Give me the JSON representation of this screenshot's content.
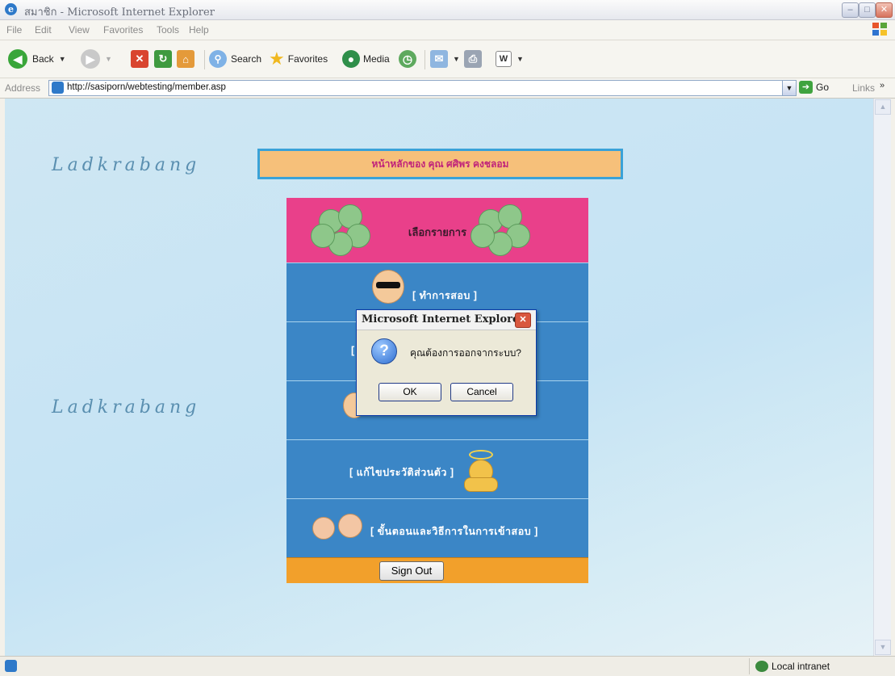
{
  "window": {
    "title": "สมาชิก - Microsoft Internet Explorer",
    "minimize": "–",
    "maximize": "□",
    "close": "✕"
  },
  "menubar": [
    "File",
    "Edit",
    "View",
    "Favorites",
    "Tools",
    "Help"
  ],
  "toolbar": {
    "back": "Back",
    "search": "Search",
    "favorites": "Favorites",
    "media": "Media"
  },
  "addressbar": {
    "label": "Address",
    "url": "http://sasiporn/webtesting/member.asp",
    "go": "Go",
    "links": "Links"
  },
  "page": {
    "brand_top": "Ladkrabang",
    "brand_mid": "Ladkrabang",
    "welcome": "หน้าหลักของ คุณ  ศศิพร   คงชลอม",
    "menu_title": "เลือกรายการ",
    "menu_items": [
      "[ ทำการสอบ ]",
      "[",
      "",
      "[ แก้ไขประวัติส่วนตัว ]",
      "[ ขั้นตอนและวิธีการในการเข้าสอบ ]"
    ],
    "signout": "Sign Out"
  },
  "dialog": {
    "title": "Microsoft Internet Explorer",
    "message": "คุณต้องการออกจากระบบ?",
    "ok": "OK",
    "cancel": "Cancel"
  },
  "statusbar": {
    "zone": "Local intranet"
  },
  "colors": {
    "content_bg": "#c5e3f4",
    "menu_header": "#e9408a",
    "menu_body": "#3b86c6",
    "menu_footer": "#f2a02b",
    "welcome_bg": "#f6c07a",
    "welcome_text": "#c0227a"
  }
}
